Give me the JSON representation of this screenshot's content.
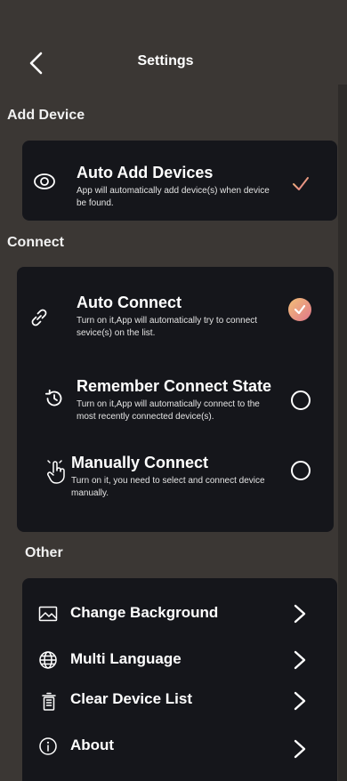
{
  "header": {
    "title": "Settings"
  },
  "add_device": {
    "section_title": "Add Device",
    "item": {
      "title": "Auto Add Devices",
      "desc": "App will automatically add device(s) when device be found.",
      "icon": "eye-icon",
      "checked": true
    }
  },
  "connect": {
    "section_title": "Connect",
    "items": [
      {
        "title": "Auto Connect",
        "desc": "Turn on it,App will automatically try to connect sevice(s) on the list.",
        "icon": "link-icon",
        "selected": true
      },
      {
        "title": "Remember Connect State",
        "desc": "Turn on it,App will automatically connect to the most recently connected device(s).",
        "icon": "history-icon",
        "selected": false
      },
      {
        "title": "Manually Connect",
        "desc": "Turn on it, you need to select and connect device manually.",
        "icon": "hand-pointer-icon",
        "selected": false
      }
    ]
  },
  "other": {
    "section_title": "Other",
    "items": [
      {
        "title": "Change Background",
        "icon": "image-icon"
      },
      {
        "title": "Multi Language",
        "icon": "globe-icon"
      },
      {
        "title": "Clear Device List",
        "icon": "trash-icon"
      },
      {
        "title": "About",
        "icon": "info-icon"
      }
    ]
  },
  "colors": {
    "background": "#3b3734",
    "card": "#15161b",
    "accent_start": "#f2c078",
    "accent_end": "#e0768a"
  }
}
